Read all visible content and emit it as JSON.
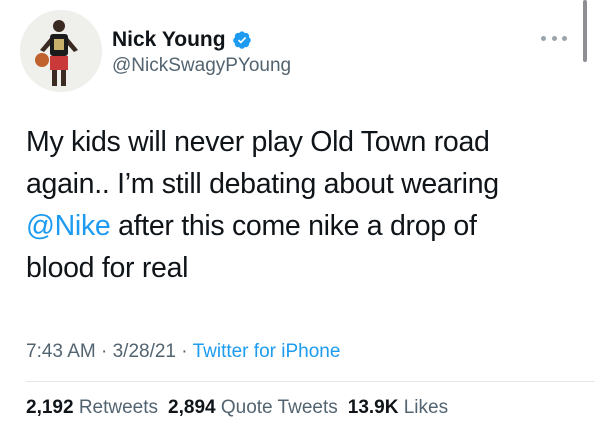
{
  "author": {
    "display_name": "Nick Young",
    "handle": "@NickSwagyPYoung",
    "verified": true,
    "avatar_icon": "profile-photo"
  },
  "tweet": {
    "line1": "My kids will never play Old Town road",
    "line2": "again.. I’m still debating about wearing",
    "line3_mention": "@Nike",
    "line3_rest": " after this come nike a drop of",
    "line4": "blood for real"
  },
  "meta": {
    "time": "7:43 AM",
    "separator1": " · ",
    "date": "3/28/21",
    "separator2": " · ",
    "source": "Twitter for iPhone"
  },
  "stats": {
    "retweets_count": "2,192",
    "retweets_label": "Retweets",
    "quote_count": "2,894",
    "quote_label": "Quote Tweets",
    "likes_count": "13.9K",
    "likes_label": "Likes"
  },
  "colors": {
    "link": "#1d9bf0",
    "verified": "#1d9bf0",
    "secondary_text": "#536471"
  }
}
